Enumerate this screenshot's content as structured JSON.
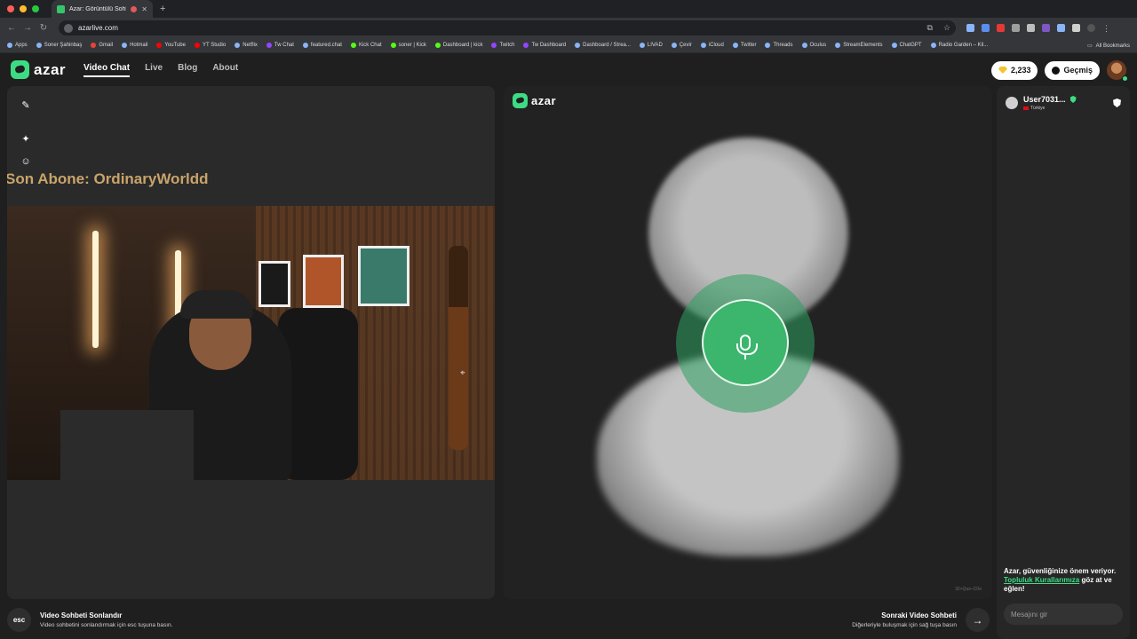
{
  "browser": {
    "tab_title": "Azar: Görüntülü Sohbet, ",
    "new_tab": "+",
    "url": "azarlive.com",
    "bookmarks": [
      "Apps",
      "Soner Şahinbaş",
      "Gmail",
      "Hotmail",
      "YouTube",
      "YT Studio",
      "Netflix",
      "Tw Chat",
      "featured.chat",
      "Kick Chat",
      "soner | Kick",
      "Dashboard | kick",
      "Twitch",
      "Tw Dashboard",
      "Dashboard / Strea...",
      "LIVAD",
      "Çevir",
      "iCloud",
      "Twitter",
      "Threads",
      "Oculus",
      "StreamElements",
      "ChatGPT",
      "Radio Garden – Kil..."
    ],
    "all_bookmarks": "All Bookmarks"
  },
  "nav": {
    "logo": "azar",
    "links": [
      "Video Chat",
      "Live",
      "Blog",
      "About"
    ],
    "gems": "2,233",
    "history": "Geçmiş"
  },
  "left": {
    "overlay_title": "Son Abone: OrdinaryWorldd"
  },
  "right_video": {
    "logo": "azar",
    "watermark": "32+Quo–C0e"
  },
  "sidebar": {
    "user_name": "User7031...",
    "country": "Türkiye",
    "safety_prefix": "Azar, güvenliğinize önem veriyor.",
    "safety_link": "Topluluk Kurallarımıza",
    "safety_suffix": "göz at ve eğlen!",
    "message_placeholder": "Mesajını gir"
  },
  "bottom": {
    "esc_key": "esc",
    "end_title": "Video Sohbeti Sonlandır",
    "end_sub": "Video sohbetini sonlandırmak için esc tuşuna basın.",
    "next_title": "Sonraki Video Sohbeti",
    "next_sub": "Diğerleriyle buluşmak için sağ tuşa basın",
    "next_arrow": "→"
  },
  "colors": {
    "accent": "#3ddc84",
    "overlay_text": "#c9a46a",
    "mic_green": "#3cb56d"
  }
}
